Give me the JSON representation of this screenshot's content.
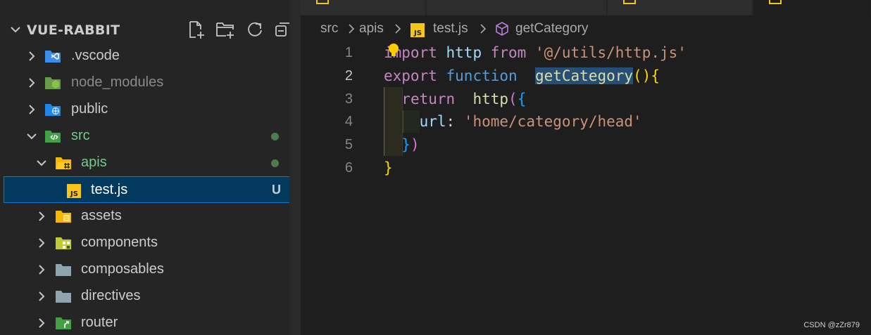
{
  "explorer": {
    "title": "VUE-RABBIT",
    "top_partial": "···",
    "actions": [
      {
        "name": "new-file-icon"
      },
      {
        "name": "new-folder-icon"
      },
      {
        "name": "refresh-icon"
      },
      {
        "name": "collapse-all-icon"
      }
    ],
    "items": [
      {
        "label": ".vscode",
        "icon": "vscode-folder-icon",
        "expanded": false,
        "depth": 0
      },
      {
        "label": "node_modules",
        "icon": "node-folder-icon",
        "expanded": false,
        "depth": 0
      },
      {
        "label": "public",
        "icon": "public-folder-icon",
        "expanded": false,
        "depth": 0
      },
      {
        "label": "src",
        "icon": "src-folder-icon",
        "expanded": true,
        "depth": 0,
        "status": "modified-dot"
      },
      {
        "label": "apis",
        "icon": "apis-folder-icon",
        "expanded": true,
        "depth": 1,
        "status": "modified-dot"
      },
      {
        "label": "test.js",
        "icon": "js-file-icon",
        "depth": 2,
        "badge": "U",
        "selected": true
      },
      {
        "label": "assets",
        "icon": "assets-folder-icon",
        "expanded": false,
        "depth": 1
      },
      {
        "label": "components",
        "icon": "components-folder-icon",
        "expanded": false,
        "depth": 1
      },
      {
        "label": "composables",
        "icon": "folder-icon",
        "expanded": false,
        "depth": 1
      },
      {
        "label": "directives",
        "icon": "folder-icon",
        "expanded": false,
        "depth": 1
      },
      {
        "label": "router",
        "icon": "router-folder-icon",
        "expanded": false,
        "depth": 1
      }
    ]
  },
  "breadcrumb": {
    "parts": [
      "src",
      "apis",
      "test.js",
      "getCategory"
    ]
  },
  "editor": {
    "line_numbers": [
      "1",
      "2",
      "3",
      "4",
      "5",
      "6"
    ],
    "current_line": 2,
    "lines": [
      [
        {
          "t": "import",
          "c": "kw"
        },
        {
          "t": " ",
          "c": "pl"
        },
        {
          "t": "http",
          "c": "id"
        },
        {
          "t": " ",
          "c": "pl"
        },
        {
          "t": "from",
          "c": "kw"
        },
        {
          "t": " ",
          "c": "pl"
        },
        {
          "t": "'@/utils/http.js'",
          "c": "st"
        }
      ],
      [
        {
          "t": "export",
          "c": "kw"
        },
        {
          "t": " ",
          "c": "pl"
        },
        {
          "t": "function",
          "c": "kb"
        },
        {
          "t": "  ",
          "c": "pl"
        },
        {
          "t": "getCategory",
          "c": "fn hl"
        },
        {
          "t": "(){",
          "c": "p1"
        }
      ],
      [
        {
          "t": "  ",
          "c": "pl"
        },
        {
          "t": "return",
          "c": "kw"
        },
        {
          "t": "  ",
          "c": "pl"
        },
        {
          "t": "http",
          "c": "fn"
        },
        {
          "t": "(",
          "c": "p2"
        },
        {
          "t": "{",
          "c": "p3"
        }
      ],
      [
        {
          "t": "    ",
          "c": "pl"
        },
        {
          "t": "url",
          "c": "id"
        },
        {
          "t": ": ",
          "c": "pl"
        },
        {
          "t": "'home/category/head'",
          "c": "st"
        }
      ],
      [
        {
          "t": "  ",
          "c": "pl"
        },
        {
          "t": "}",
          "c": "p3"
        },
        {
          "t": ")",
          "c": "p2"
        }
      ],
      [
        {
          "t": "}",
          "c": "p1"
        }
      ]
    ]
  },
  "watermark": "CSDN @zZr879",
  "colors": {
    "accent_selection": "#04395e",
    "folder_src": "#4caf50",
    "folder_yellow": "#f5b800",
    "js_icon": "#f5c518"
  }
}
